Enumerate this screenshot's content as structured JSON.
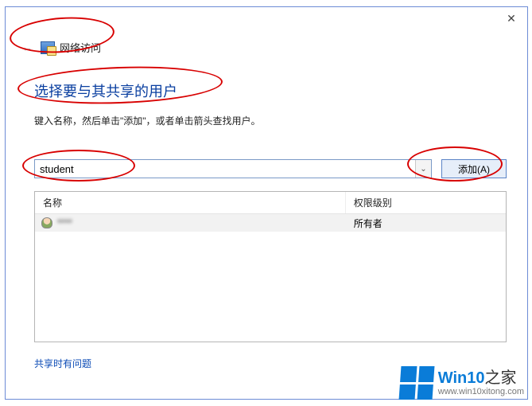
{
  "titlebar": {
    "close_glyph": "✕"
  },
  "back": {
    "glyph": "←"
  },
  "breadcrumb": {
    "label": "网络访问"
  },
  "heading": "选择要与其共享的用户",
  "instruction": "键入名称，然后单击\"添加\"，或者单击箭头查找用户。",
  "input": {
    "value": "student",
    "dropdown_glyph": "⌄"
  },
  "add_button": "添加(A)",
  "columns": {
    "name": "名称",
    "permission": "权限级别"
  },
  "rows": [
    {
      "name": "****",
      "permission": "所有者"
    }
  ],
  "help_link": "共享时有问题",
  "watermark": {
    "brand_main": "Win10",
    "brand_suffix": "之家",
    "url": "www.win10xitong.com"
  }
}
